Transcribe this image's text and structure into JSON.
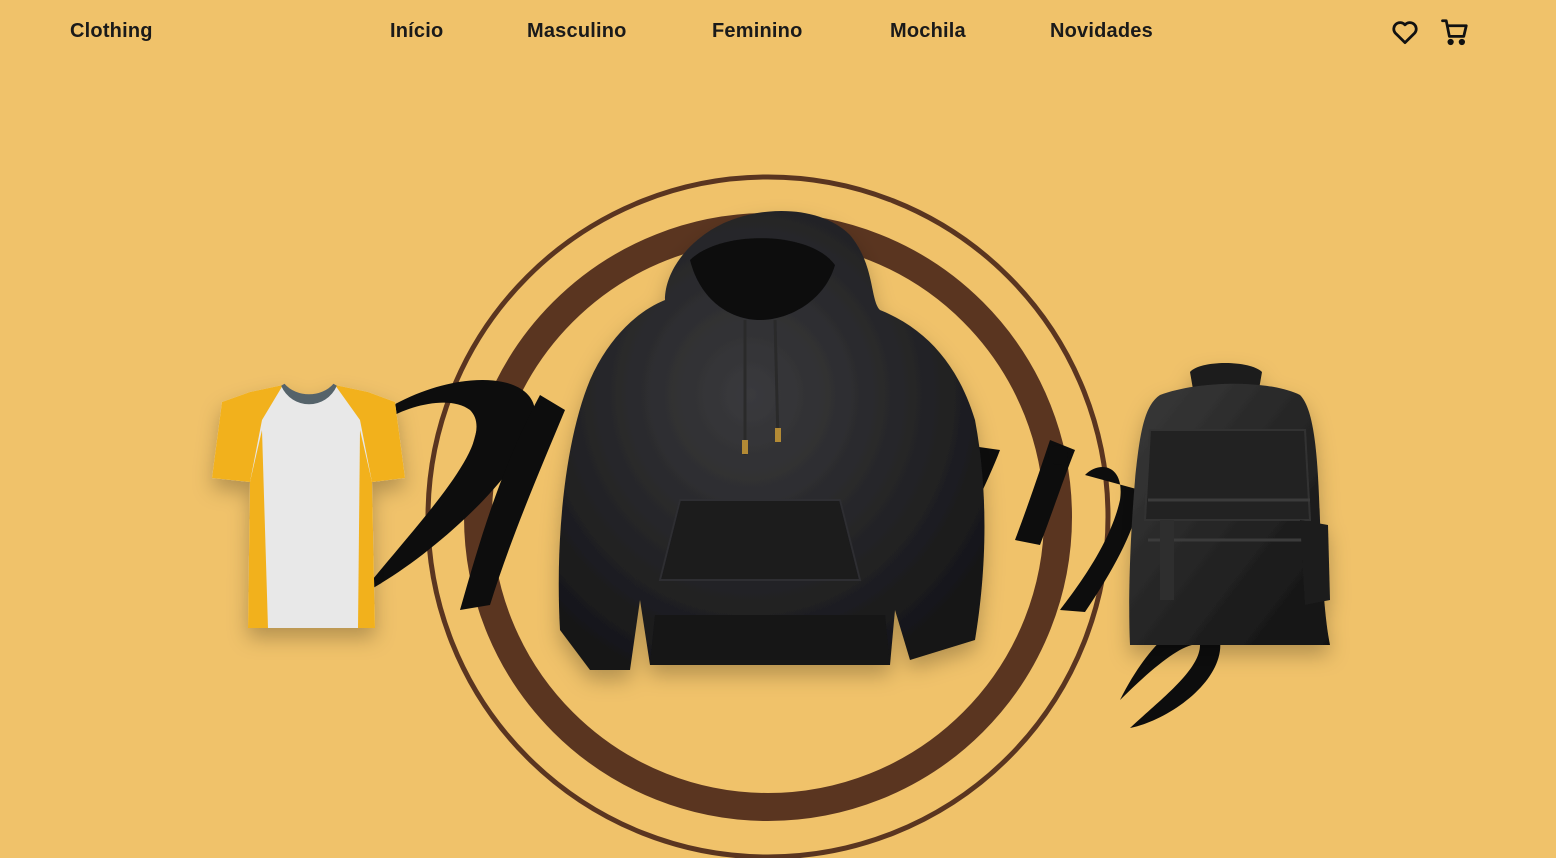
{
  "header": {
    "brand": "Clothing",
    "nav": [
      {
        "label": "Início"
      },
      {
        "label": "Masculino"
      },
      {
        "label": "Feminino"
      },
      {
        "label": "Mochila"
      },
      {
        "label": "Novidades"
      }
    ],
    "icons": {
      "favorites": "heart-icon",
      "cart": "cart-icon"
    }
  },
  "hero": {
    "products": [
      {
        "name": "tshirt-image"
      },
      {
        "name": "hoodie-image"
      },
      {
        "name": "backpack-image"
      }
    ],
    "colors": {
      "background": "#f0c26a",
      "ring": "#5a3520",
      "hoodie": "#1f1f21",
      "tshirt_accent": "#f2b11e",
      "tshirt_body": "#e6e6e6"
    }
  }
}
